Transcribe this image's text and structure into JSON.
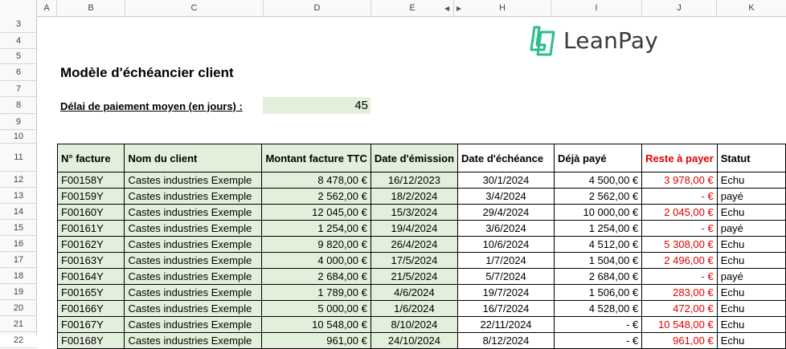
{
  "columns": [
    "A",
    "B",
    "C",
    "D",
    "E",
    "H",
    "I",
    "J",
    "K"
  ],
  "rows": [
    "3",
    "4",
    "5",
    "6",
    "7",
    "8",
    "9",
    "10",
    "11",
    "12",
    "13",
    "14",
    "15",
    "16",
    "17",
    "18",
    "19",
    "20",
    "21",
    "22"
  ],
  "title": "Modèle d'échéancier client",
  "delai": {
    "label": "Délai de paiement moyen (en jours) :",
    "value": "45"
  },
  "logo": {
    "name": "LeanPay",
    "color": "#2bbf8a"
  },
  "table": {
    "headers": [
      "N° facture",
      "Nom du client",
      "Montant facture TTC",
      "Date d'émission",
      "Date d'échéance",
      "Déjà payé",
      "Reste à payer",
      "Statut"
    ],
    "rows": [
      {
        "num": "F00158Y",
        "client": "Castes industries Exemple",
        "montant": "8 478,00 €",
        "emission": "16/12/2023",
        "echeance": "30/1/2024",
        "paye": "4 500,00 €",
        "reste": "3 978,00 €",
        "statut": "Echu"
      },
      {
        "num": "F00159Y",
        "client": "Castes industries Exemple",
        "montant": "2 562,00 €",
        "emission": "18/2/2024",
        "echeance": "3/4/2024",
        "paye": "2 562,00 €",
        "reste": "-      €",
        "statut": "payé"
      },
      {
        "num": "F00160Y",
        "client": "Castes industries Exemple",
        "montant": "12 045,00 €",
        "emission": "15/3/2024",
        "echeance": "29/4/2024",
        "paye": "10 000,00 €",
        "reste": "2 045,00 €",
        "statut": "Echu"
      },
      {
        "num": "F00161Y",
        "client": "Castes industries Exemple",
        "montant": "1 254,00 €",
        "emission": "19/4/2024",
        "echeance": "3/6/2024",
        "paye": "1 254,00 €",
        "reste": "-      €",
        "statut": "payé"
      },
      {
        "num": "F00162Y",
        "client": "Castes industries Exemple",
        "montant": "9 820,00 €",
        "emission": "26/4/2024",
        "echeance": "10/6/2024",
        "paye": "4 512,00 €",
        "reste": "5 308,00 €",
        "statut": "Echu"
      },
      {
        "num": "F00163Y",
        "client": "Castes industries Exemple",
        "montant": "4 000,00 €",
        "emission": "17/5/2024",
        "echeance": "1/7/2024",
        "paye": "1 504,00 €",
        "reste": "2 496,00 €",
        "statut": "Echu"
      },
      {
        "num": "F00164Y",
        "client": "Castes industries Exemple",
        "montant": "2 684,00 €",
        "emission": "21/5/2024",
        "echeance": "5/7/2024",
        "paye": "2 684,00 €",
        "reste": "-      €",
        "statut": "payé"
      },
      {
        "num": "F00165Y",
        "client": "Castes industries Exemple",
        "montant": "1 789,00 €",
        "emission": "4/6/2024",
        "echeance": "19/7/2024",
        "paye": "1 506,00 €",
        "reste": "283,00 €",
        "statut": "Echu"
      },
      {
        "num": "F00166Y",
        "client": "Castes industries Exemple",
        "montant": "5 000,00 €",
        "emission": "1/6/2024",
        "echeance": "16/7/2024",
        "paye": "4 528,00 €",
        "reste": "472,00 €",
        "statut": "Echu"
      },
      {
        "num": "F00167Y",
        "client": "Castes industries Exemple",
        "montant": "10 548,00 €",
        "emission": "8/10/2024",
        "echeance": "22/11/2024",
        "paye": "-      €",
        "reste": "10 548,00 €",
        "statut": "Echu"
      },
      {
        "num": "F00168Y",
        "client": "Castes industries Exemple",
        "montant": "961,00 €",
        "emission": "24/10/2024",
        "echeance": "8/12/2024",
        "paye": "-      €",
        "reste": "961,00 €",
        "statut": "Echu"
      }
    ]
  }
}
